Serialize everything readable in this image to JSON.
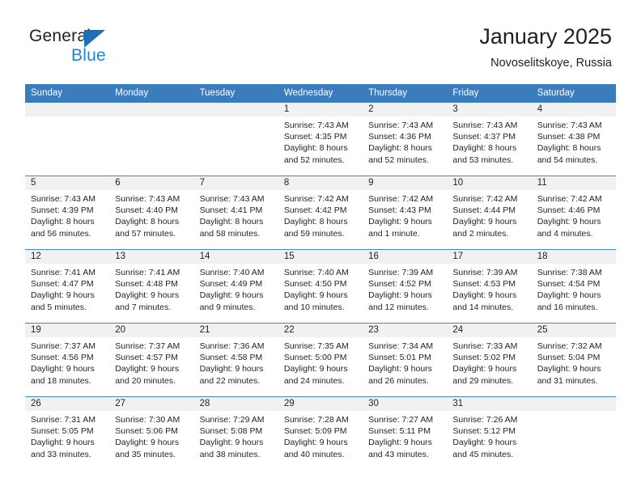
{
  "brand": {
    "name_part1": "General",
    "name_part2": "Blue",
    "flag_icon": "triangle-flag-icon",
    "accent_dark": "#1d6fb8",
    "accent_light": "#1b87d2"
  },
  "header": {
    "title": "January 2025",
    "subtitle": "Novoselitskoye, Russia"
  },
  "theme": {
    "header_row_bg": "#3a7cbe",
    "daynum_band_bg": "#f1f1f1",
    "row_divider": "#4a86c5",
    "text": "#231f20"
  },
  "weekday_headers": [
    "Sunday",
    "Monday",
    "Tuesday",
    "Wednesday",
    "Thursday",
    "Friday",
    "Saturday"
  ],
  "weeks": [
    [
      {
        "day": "",
        "lines": []
      },
      {
        "day": "",
        "lines": []
      },
      {
        "day": "",
        "lines": []
      },
      {
        "day": "1",
        "lines": [
          "Sunrise: 7:43 AM",
          "Sunset: 4:35 PM",
          "Daylight: 8 hours",
          "and 52 minutes."
        ]
      },
      {
        "day": "2",
        "lines": [
          "Sunrise: 7:43 AM",
          "Sunset: 4:36 PM",
          "Daylight: 8 hours",
          "and 52 minutes."
        ]
      },
      {
        "day": "3",
        "lines": [
          "Sunrise: 7:43 AM",
          "Sunset: 4:37 PM",
          "Daylight: 8 hours",
          "and 53 minutes."
        ]
      },
      {
        "day": "4",
        "lines": [
          "Sunrise: 7:43 AM",
          "Sunset: 4:38 PM",
          "Daylight: 8 hours",
          "and 54 minutes."
        ]
      }
    ],
    [
      {
        "day": "5",
        "lines": [
          "Sunrise: 7:43 AM",
          "Sunset: 4:39 PM",
          "Daylight: 8 hours",
          "and 56 minutes."
        ]
      },
      {
        "day": "6",
        "lines": [
          "Sunrise: 7:43 AM",
          "Sunset: 4:40 PM",
          "Daylight: 8 hours",
          "and 57 minutes."
        ]
      },
      {
        "day": "7",
        "lines": [
          "Sunrise: 7:43 AM",
          "Sunset: 4:41 PM",
          "Daylight: 8 hours",
          "and 58 minutes."
        ]
      },
      {
        "day": "8",
        "lines": [
          "Sunrise: 7:42 AM",
          "Sunset: 4:42 PM",
          "Daylight: 8 hours",
          "and 59 minutes."
        ]
      },
      {
        "day": "9",
        "lines": [
          "Sunrise: 7:42 AM",
          "Sunset: 4:43 PM",
          "Daylight: 9 hours",
          "and 1 minute."
        ]
      },
      {
        "day": "10",
        "lines": [
          "Sunrise: 7:42 AM",
          "Sunset: 4:44 PM",
          "Daylight: 9 hours",
          "and 2 minutes."
        ]
      },
      {
        "day": "11",
        "lines": [
          "Sunrise: 7:42 AM",
          "Sunset: 4:46 PM",
          "Daylight: 9 hours",
          "and 4 minutes."
        ]
      }
    ],
    [
      {
        "day": "12",
        "lines": [
          "Sunrise: 7:41 AM",
          "Sunset: 4:47 PM",
          "Daylight: 9 hours",
          "and 5 minutes."
        ]
      },
      {
        "day": "13",
        "lines": [
          "Sunrise: 7:41 AM",
          "Sunset: 4:48 PM",
          "Daylight: 9 hours",
          "and 7 minutes."
        ]
      },
      {
        "day": "14",
        "lines": [
          "Sunrise: 7:40 AM",
          "Sunset: 4:49 PM",
          "Daylight: 9 hours",
          "and 9 minutes."
        ]
      },
      {
        "day": "15",
        "lines": [
          "Sunrise: 7:40 AM",
          "Sunset: 4:50 PM",
          "Daylight: 9 hours",
          "and 10 minutes."
        ]
      },
      {
        "day": "16",
        "lines": [
          "Sunrise: 7:39 AM",
          "Sunset: 4:52 PM",
          "Daylight: 9 hours",
          "and 12 minutes."
        ]
      },
      {
        "day": "17",
        "lines": [
          "Sunrise: 7:39 AM",
          "Sunset: 4:53 PM",
          "Daylight: 9 hours",
          "and 14 minutes."
        ]
      },
      {
        "day": "18",
        "lines": [
          "Sunrise: 7:38 AM",
          "Sunset: 4:54 PM",
          "Daylight: 9 hours",
          "and 16 minutes."
        ]
      }
    ],
    [
      {
        "day": "19",
        "lines": [
          "Sunrise: 7:37 AM",
          "Sunset: 4:56 PM",
          "Daylight: 9 hours",
          "and 18 minutes."
        ]
      },
      {
        "day": "20",
        "lines": [
          "Sunrise: 7:37 AM",
          "Sunset: 4:57 PM",
          "Daylight: 9 hours",
          "and 20 minutes."
        ]
      },
      {
        "day": "21",
        "lines": [
          "Sunrise: 7:36 AM",
          "Sunset: 4:58 PM",
          "Daylight: 9 hours",
          "and 22 minutes."
        ]
      },
      {
        "day": "22",
        "lines": [
          "Sunrise: 7:35 AM",
          "Sunset: 5:00 PM",
          "Daylight: 9 hours",
          "and 24 minutes."
        ]
      },
      {
        "day": "23",
        "lines": [
          "Sunrise: 7:34 AM",
          "Sunset: 5:01 PM",
          "Daylight: 9 hours",
          "and 26 minutes."
        ]
      },
      {
        "day": "24",
        "lines": [
          "Sunrise: 7:33 AM",
          "Sunset: 5:02 PM",
          "Daylight: 9 hours",
          "and 29 minutes."
        ]
      },
      {
        "day": "25",
        "lines": [
          "Sunrise: 7:32 AM",
          "Sunset: 5:04 PM",
          "Daylight: 9 hours",
          "and 31 minutes."
        ]
      }
    ],
    [
      {
        "day": "26",
        "lines": [
          "Sunrise: 7:31 AM",
          "Sunset: 5:05 PM",
          "Daylight: 9 hours",
          "and 33 minutes."
        ]
      },
      {
        "day": "27",
        "lines": [
          "Sunrise: 7:30 AM",
          "Sunset: 5:06 PM",
          "Daylight: 9 hours",
          "and 35 minutes."
        ]
      },
      {
        "day": "28",
        "lines": [
          "Sunrise: 7:29 AM",
          "Sunset: 5:08 PM",
          "Daylight: 9 hours",
          "and 38 minutes."
        ]
      },
      {
        "day": "29",
        "lines": [
          "Sunrise: 7:28 AM",
          "Sunset: 5:09 PM",
          "Daylight: 9 hours",
          "and 40 minutes."
        ]
      },
      {
        "day": "30",
        "lines": [
          "Sunrise: 7:27 AM",
          "Sunset: 5:11 PM",
          "Daylight: 9 hours",
          "and 43 minutes."
        ]
      },
      {
        "day": "31",
        "lines": [
          "Sunrise: 7:26 AM",
          "Sunset: 5:12 PM",
          "Daylight: 9 hours",
          "and 45 minutes."
        ]
      },
      {
        "day": "",
        "lines": []
      }
    ]
  ]
}
